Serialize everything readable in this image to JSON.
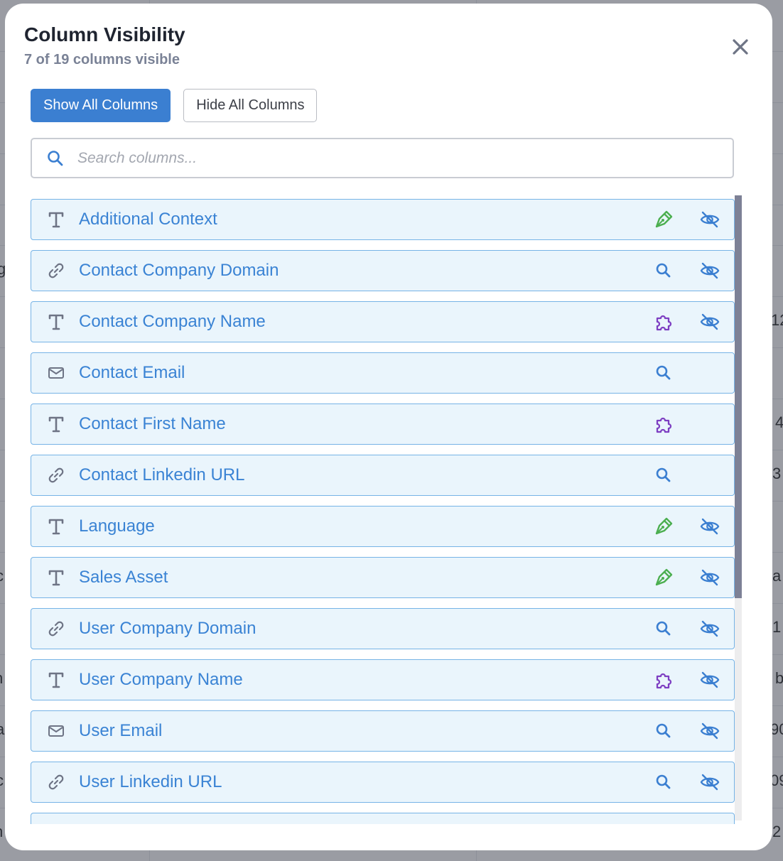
{
  "background": {
    "fragments": [
      "g",
      "12",
      "4",
      "3",
      "a",
      "1",
      "b",
      "90",
      "09",
      "2",
      "c",
      "n",
      "a",
      "c",
      "n"
    ]
  },
  "modal": {
    "title": "Column Visibility",
    "subtitle": "7 of 19 columns visible",
    "close_icon": "close-icon",
    "show_all_label": "Show All Columns",
    "hide_all_label": "Hide All Columns",
    "search_placeholder": "Search columns...",
    "colors": {
      "accent": "#3b7fd1",
      "row_bg": "#eaf5fc",
      "row_border": "#76b3e6",
      "label": "#3a83d4",
      "ai_green": "#4caf50",
      "integration_purple": "#7e3fc2",
      "lookup_blue": "#3b7fd1"
    }
  },
  "columns": [
    {
      "label": "Additional Context",
      "type": "text",
      "source": "ai",
      "hidden": true
    },
    {
      "label": "Contact Company Domain",
      "type": "link",
      "source": "lookup",
      "hidden": true
    },
    {
      "label": "Contact Company Name",
      "type": "text",
      "source": "integration",
      "hidden": true
    },
    {
      "label": "Contact Email",
      "type": "email",
      "source": "lookup",
      "hidden": false
    },
    {
      "label": "Contact First Name",
      "type": "text",
      "source": "integration",
      "hidden": false
    },
    {
      "label": "Contact Linkedin URL",
      "type": "link",
      "source": "lookup",
      "hidden": false
    },
    {
      "label": "Language",
      "type": "text",
      "source": "ai",
      "hidden": true
    },
    {
      "label": "Sales Asset",
      "type": "text",
      "source": "ai",
      "hidden": true
    },
    {
      "label": "User Company Domain",
      "type": "link",
      "source": "lookup",
      "hidden": true
    },
    {
      "label": "User Company Name",
      "type": "text",
      "source": "integration",
      "hidden": true
    },
    {
      "label": "User Email",
      "type": "email",
      "source": "lookup",
      "hidden": true
    },
    {
      "label": "User Linkedin URL",
      "type": "link",
      "source": "lookup",
      "hidden": true
    },
    {
      "label": "",
      "type": "text",
      "source": "integration",
      "hidden": true
    }
  ]
}
